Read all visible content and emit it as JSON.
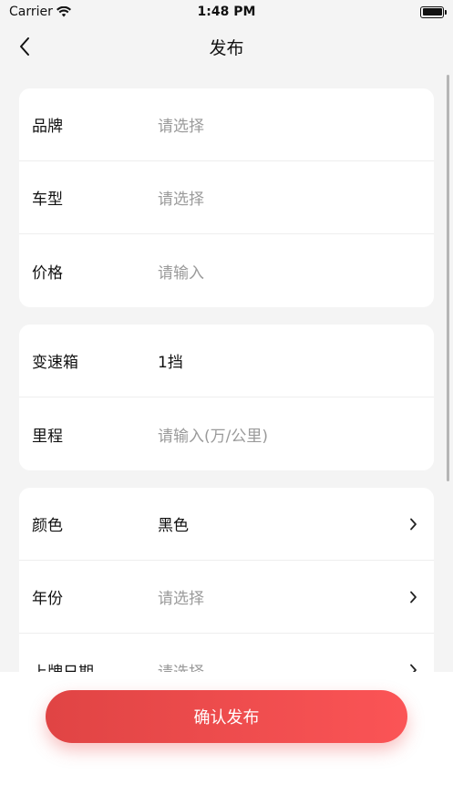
{
  "status_bar": {
    "carrier": "Carrier",
    "time": "1:48 PM"
  },
  "nav": {
    "title": "发布"
  },
  "groups": [
    [
      {
        "label": "品牌",
        "value": "请选择",
        "placeholder": true,
        "chevron": false
      },
      {
        "label": "车型",
        "value": "请选择",
        "placeholder": true,
        "chevron": false
      },
      {
        "label": "价格",
        "value": "请输入",
        "placeholder": true,
        "chevron": false
      }
    ],
    [
      {
        "label": "变速箱",
        "value": "1挡",
        "placeholder": false,
        "chevron": false
      },
      {
        "label": "里程",
        "value": "请输入(万/公里)",
        "placeholder": true,
        "chevron": false
      }
    ],
    [
      {
        "label": "颜色",
        "value": "黑色",
        "placeholder": false,
        "chevron": true
      },
      {
        "label": "年份",
        "value": "请选择",
        "placeholder": true,
        "chevron": true
      },
      {
        "label": "上牌日期",
        "value": "请选择",
        "placeholder": true,
        "chevron": true
      }
    ]
  ],
  "footer": {
    "confirm_label": "确认发布"
  }
}
